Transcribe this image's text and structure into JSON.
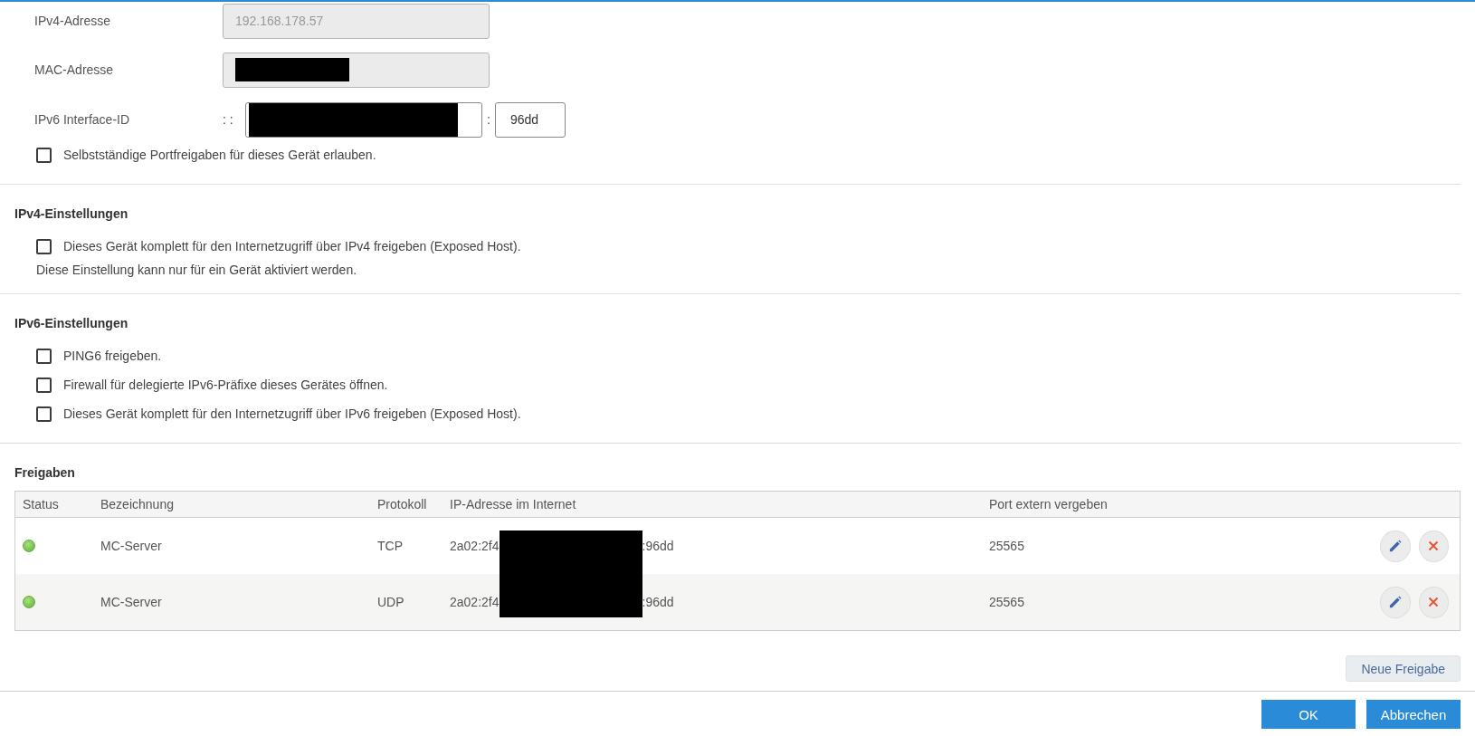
{
  "device": {
    "fields": [
      {
        "label": "IPv4-Adresse",
        "value": "192.168.178.57",
        "redacted": false
      },
      {
        "label": "MAC-Adresse",
        "redacted": true
      }
    ],
    "interface_id": {
      "label": "IPv6 Interface-ID",
      "prefix": ": :",
      "redacted": true,
      "separator": ":",
      "value": "96dd"
    },
    "options": [
      {
        "label": "Selbstständige Portfreigaben für dieses Gerät erlauben.",
        "checked": false
      }
    ]
  },
  "sections": [
    {
      "title": "IPv4-Einstellungen",
      "options": [
        {
          "label": "Dieses Gerät komplett für den Internetzugriff über IPv4 freigeben (Exposed Host).",
          "checked": false
        }
      ],
      "note": "Diese Einstellung kann nur für ein Gerät aktiviert werden."
    },
    {
      "title": "IPv6-Einstellungen",
      "options": [
        {
          "label": "PING6 freigeben.",
          "checked": false
        },
        {
          "label": "Firewall für delegierte IPv6-Präfixe dieses Gerätes öffnen.",
          "checked": false
        },
        {
          "label": "Dieses Gerät komplett für den Internetzugriff über IPv6 freigeben (Exposed Host).",
          "checked": false
        }
      ]
    }
  ],
  "shares": {
    "title": "Freigaben",
    "columns": [
      "Status",
      "Bezeichnung",
      "Protokoll",
      "IP-Adresse im Internet",
      "Port extern vergeben"
    ],
    "rows": [
      {
        "active": true,
        "name": "MC-Server",
        "protocol": "TCP",
        "ip_start": "2a02:2f4",
        "ip_redacted": true,
        "ip_end": ":96dd",
        "port": "25565"
      },
      {
        "active": true,
        "name": "MC-Server",
        "protocol": "UDP",
        "ip_start": "2a02:2f4",
        "ip_redacted": true,
        "ip_end": ":96dd",
        "port": "25565"
      }
    ],
    "new_button": "Neue Freigabe"
  },
  "footer": {
    "buttons": [
      "OK",
      "Abbrechen"
    ]
  }
}
